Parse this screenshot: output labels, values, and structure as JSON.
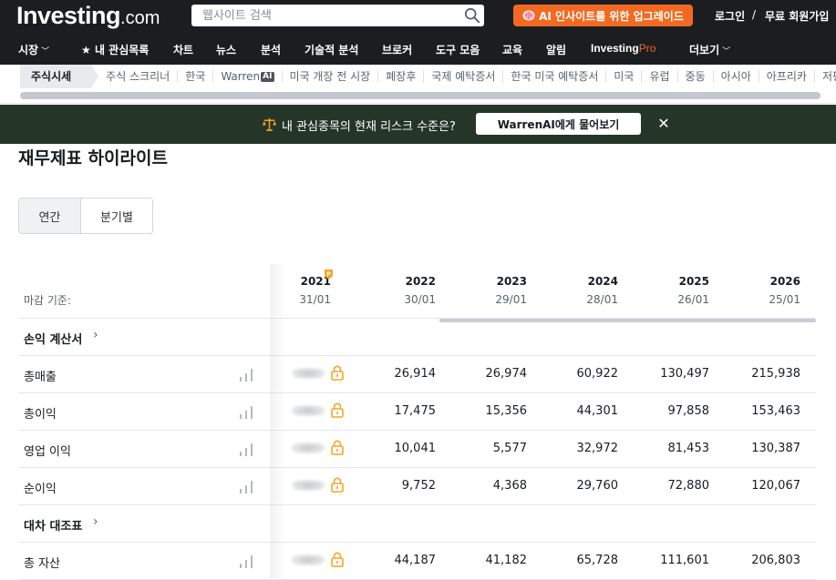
{
  "header": {
    "logo_main": "Investing",
    "logo_suffix": ".com",
    "search_placeholder": "웹사이트 검색",
    "upgrade_label": "AI 인사이트를 위한 업그레이드",
    "login_label": "로그인",
    "separator": "/",
    "signup_label": "무료 회원가입"
  },
  "main_nav": {
    "items": [
      "시장",
      "내 관심목록",
      "차트",
      "뉴스",
      "분석",
      "기술적 분석",
      "브로커",
      "도구 모음",
      "교육",
      "알림",
      "InvestingPro",
      "더보기"
    ]
  },
  "sub_nav": {
    "items": [
      "주식시세",
      "주식 스크리너",
      "한국",
      "Warren",
      "미국 개장 전 시장",
      "폐장후",
      "국제 예탁증서",
      "한국 미국 예탁증서",
      "미국",
      "유럽",
      "중동",
      "아시아",
      "아프리카",
      "저평가"
    ],
    "warren_badge": "AI"
  },
  "banner": {
    "text": "내 관심종목의 현재 리스크 수준은?",
    "button_label": "WarrenAI에게 물어보기",
    "close_symbol": "✕"
  },
  "section_title": "재무제표 하이라이트",
  "period_toggle": {
    "annual_label": "연간",
    "quarterly_label": "분기별",
    "selected": "annual"
  },
  "table": {
    "basis_label": "마감 기준:",
    "columns": [
      {
        "year": "2021",
        "date": "31/01",
        "locked": true
      },
      {
        "year": "2022",
        "date": "30/01",
        "locked": false
      },
      {
        "year": "2023",
        "date": "29/01",
        "locked": false
      },
      {
        "year": "2024",
        "date": "28/01",
        "locked": false
      },
      {
        "year": "2025",
        "date": "26/01",
        "locked": false
      },
      {
        "year": "2026",
        "date": "25/01",
        "locked": false
      }
    ],
    "sections": [
      {
        "title": "손익 계산서",
        "rows": [
          {
            "label": "총매출",
            "values": [
              "26,914",
              "26,974",
              "60,922",
              "130,497",
              "215,938"
            ]
          },
          {
            "label": "총이익",
            "values": [
              "17,475",
              "15,356",
              "44,301",
              "97,858",
              "153,463"
            ]
          },
          {
            "label": "영업 이익",
            "values": [
              "10,041",
              "5,577",
              "32,972",
              "81,453",
              "130,387"
            ]
          },
          {
            "label": "순이익",
            "values": [
              "9,752",
              "4,368",
              "29,760",
              "72,880",
              "120,067"
            ]
          }
        ]
      },
      {
        "title": "대차 대조표",
        "rows": [
          {
            "label": "총 자산",
            "values": [
              "44,187",
              "41,182",
              "65,728",
              "111,601",
              "206,803"
            ]
          }
        ]
      }
    ]
  },
  "colors": {
    "topbar_bg": "#1b1d21",
    "upgrade_orange": "#f26a21",
    "banner_bg": "#253628",
    "lock_orange": "#f5a623",
    "pro_orange": "#f5a623"
  }
}
